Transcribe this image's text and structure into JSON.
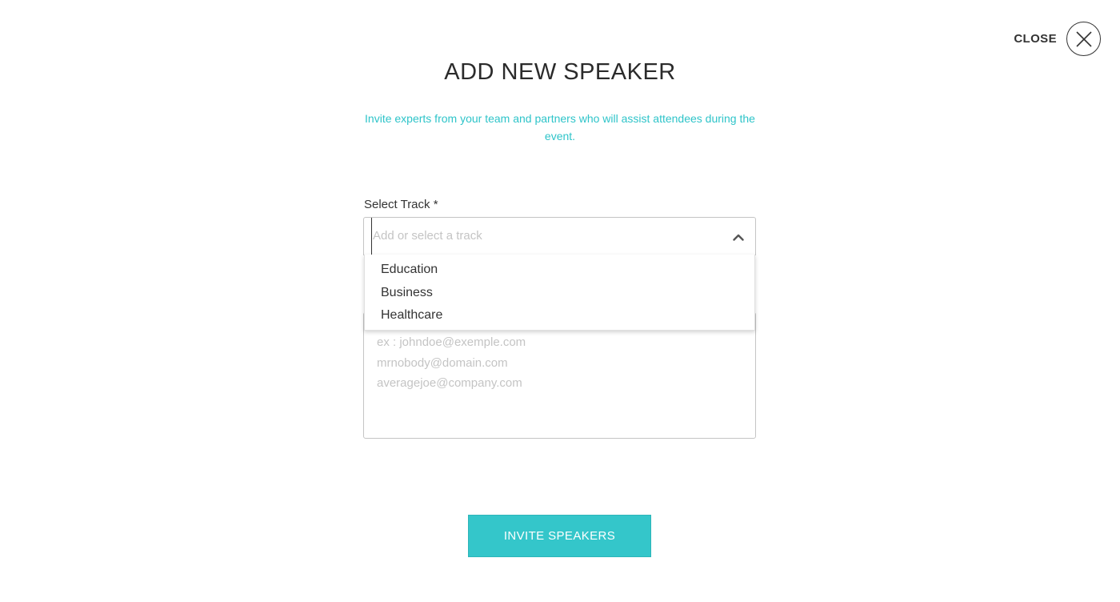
{
  "header": {
    "close_label": "CLOSE",
    "close_icon": "close-icon"
  },
  "modal": {
    "title": "ADD NEW SPEAKER",
    "subtitle": "Invite experts from your team and partners who will assist attendees during the event."
  },
  "track": {
    "label": "Select Track *",
    "value": "",
    "placeholder": "Add or select a track",
    "expanded": true,
    "options": [
      {
        "label": "Education"
      },
      {
        "label": "Business"
      },
      {
        "label": "Healthcare"
      }
    ]
  },
  "emails": {
    "value": "",
    "placeholder_lines": [
      "ex : johndoe@exemple.com",
      "mrnobody@domain.com",
      "averagejoe@company.com"
    ]
  },
  "actions": {
    "invite_label": "INVITE SPEAKERS"
  },
  "colors": {
    "accent": "#34c6ca",
    "subtitle": "#2ec4c9",
    "text": "#333333",
    "placeholder": "#c4c4c4",
    "border": "#c4c4c4"
  }
}
